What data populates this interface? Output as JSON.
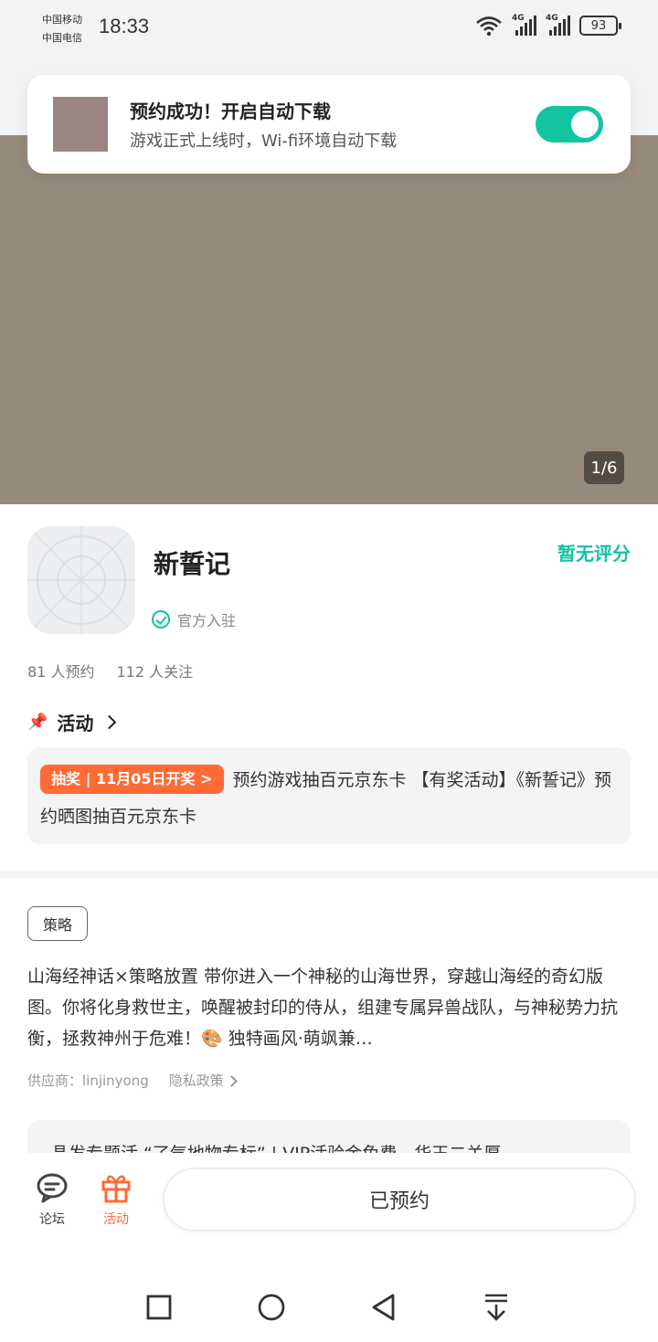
{
  "status_bar": {
    "carrier_1": "中国移动",
    "carrier_2": "中国电信",
    "time": "18:33",
    "net_1": "4G",
    "net_2": "4G",
    "battery": "93"
  },
  "notification": {
    "title": "预约成功！开启自动下载",
    "subtitle": "游戏正式上线时，Wi-fi环境自动下载",
    "toggle_on": true,
    "accent": "#13c4a3"
  },
  "hero": {
    "pager": "1/6",
    "image_color": "#968a7b"
  },
  "app": {
    "name": "新誓记",
    "rating": "暂无评分",
    "official": "官方入驻",
    "reservations": "81 人预约",
    "followers": "112 人关注"
  },
  "activity": {
    "heading": "活动",
    "lottery_badge": "抽奖 | 11月05日开奖 >",
    "text": "预约游戏抽百元京东卡 【有奖活动】《新誓记》预约晒图抽百元京东卡"
  },
  "intro": {
    "tag": "策略",
    "description": "山海经神话×策略放置 带你进入一个神秘的山海世界，穿越山海经的奇幻版图。你将化身救世主，唤醒被封印的侍从，组建专属异兽战队，与神秘势力抗衡，拯救神州于危难！🎨 独特画风·萌飒兼…",
    "supplier": "供应商：linjinyong",
    "privacy": "隐私政策",
    "peek_text": "晶发专题活 “了气地物专标” | VIP活验金免费，华王二关厚"
  },
  "bottom_bar": {
    "forum_label": "论坛",
    "activity_label": "活动",
    "reserve_button": "已预约",
    "active_color": "#ff6b35"
  },
  "system_nav": [
    "square-icon",
    "circle-icon",
    "back-triangle-icon",
    "download-arrow-icon"
  ]
}
